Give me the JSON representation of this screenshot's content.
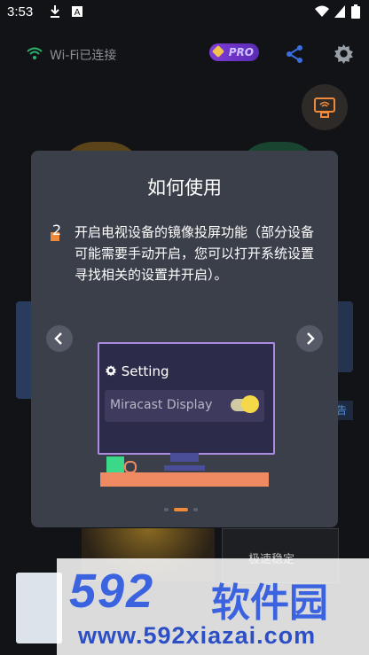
{
  "status_bar": {
    "time": "3:53"
  },
  "header": {
    "wifi_status": "Wi-Fi已连接",
    "pro_label": "PRO"
  },
  "background": {
    "card_tag": "告",
    "bottom_card_label": "极速稳定"
  },
  "dialog": {
    "title": "如何使用",
    "step_number": "2",
    "step_text": "开启电视设备的镜像投屏功能（部分设备可能需要手动开启，您可以打开系统设置寻找相关的设置并开启）。",
    "illustration": {
      "setting_label": "Setting",
      "option_label": "Miracast Display"
    },
    "page_indicator": {
      "count": 3,
      "active_index": 1
    }
  },
  "watermark": {
    "brand": "592",
    "brand_cn": "软件园",
    "url": "www.592xiazai.com"
  },
  "colors": {
    "accent": "#f08a3a",
    "dialog_bg": "#3b3f4a",
    "pro_purple": "#7e3cd6",
    "watermark_blue": "#3b63e0"
  },
  "icons": [
    "download-icon",
    "app-icon",
    "wifi-signal-icon",
    "cell-signal-icon",
    "battery-icon",
    "wifi-icon",
    "share-icon",
    "gear-icon",
    "screen-cast-icon",
    "chevron-left-icon",
    "chevron-right-icon",
    "gear-small-icon"
  ]
}
